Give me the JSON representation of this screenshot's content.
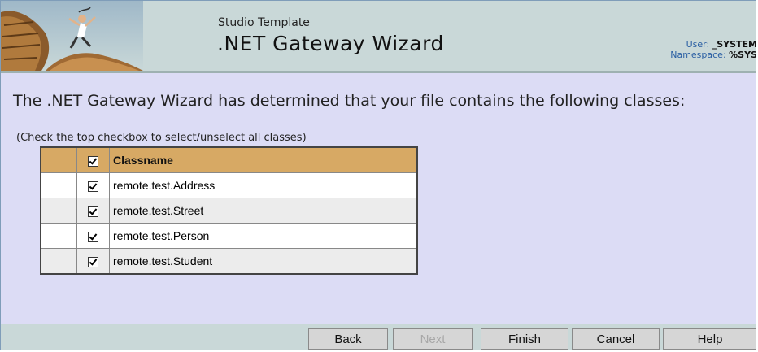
{
  "header": {
    "subtitle": "Studio Template",
    "title": ".NET Gateway Wizard",
    "user_label": "User:",
    "user_value": "_SYSTEM",
    "namespace_label": "Namespace:",
    "namespace_value": "%SYS"
  },
  "main": {
    "intro": "The .NET Gateway Wizard has determined that your file contains the following classes:",
    "hint": "(Check the top checkbox to select/unselect all classes)",
    "table": {
      "header": "Classname",
      "select_all_checked": true,
      "rows": [
        {
          "name": "remote.test.Address",
          "checked": true
        },
        {
          "name": "remote.test.Street",
          "checked": true
        },
        {
          "name": "remote.test.Person",
          "checked": true
        },
        {
          "name": "remote.test.Student",
          "checked": true
        }
      ]
    }
  },
  "footer": {
    "back": "Back",
    "next": "Next",
    "finish": "Finish",
    "cancel": "Cancel",
    "help": "Help"
  },
  "colors": {
    "header_bg": "#c9d8d8",
    "content_bg": "#dcdcf5",
    "table_header_bg": "#d7a964"
  }
}
